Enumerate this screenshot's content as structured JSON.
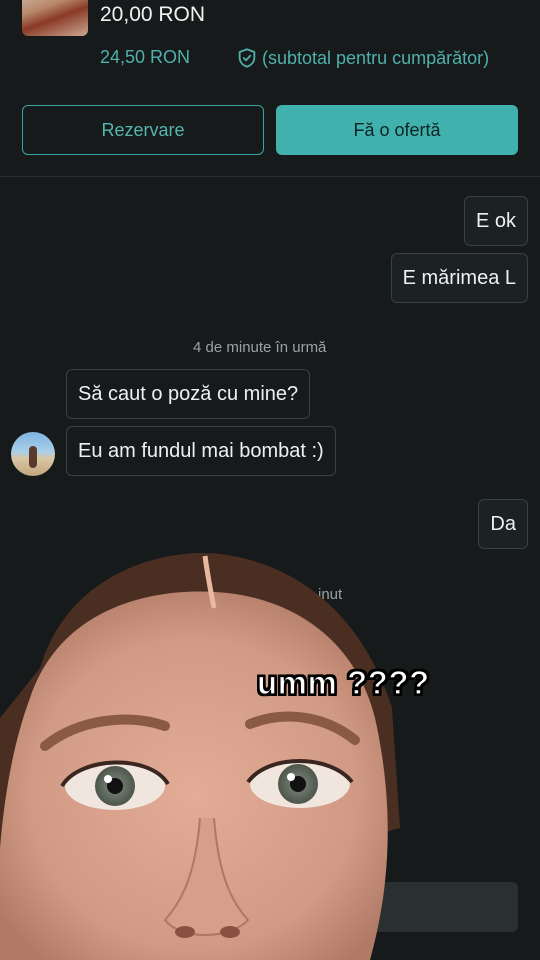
{
  "listing": {
    "price": "20,00 RON",
    "buyer_total": "24,50 RON",
    "protection_label": "(subtotal pentru cumpărător)"
  },
  "actions": {
    "reserve_label": "Rezervare",
    "offer_label": "Fă o ofertă"
  },
  "messages": {
    "outgoing_1": "E ok",
    "outgoing_2": "E mărimea L",
    "timestamp_1": "4 de minute în urmă",
    "incoming_1": "Să caut o poză cu mine?",
    "incoming_2": "Eu am fundul mai bombat :)",
    "outgoing_3": "Da",
    "timestamp_2_partial": "inut"
  },
  "overlay": {
    "caption": "umm ????"
  },
  "colors": {
    "accent": "#41b1ad",
    "background": "#161a1b"
  }
}
